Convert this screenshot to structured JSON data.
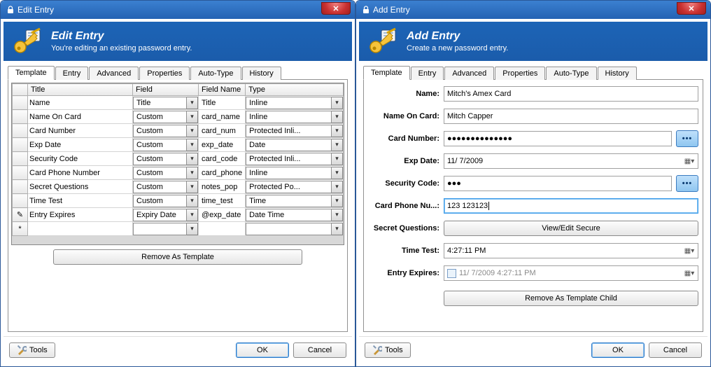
{
  "tabs": [
    "Template",
    "Entry",
    "Advanced",
    "Properties",
    "Auto-Type",
    "History"
  ],
  "left": {
    "title": "Edit Entry",
    "banner_title": "Edit Entry",
    "banner_sub": "You're editing an existing password entry.",
    "grid": {
      "headers": [
        "",
        "Title",
        "Field",
        "Field Name",
        "Type"
      ],
      "rows": [
        {
          "rh": "",
          "title": "Name",
          "field": "Title",
          "fname": "Title",
          "type": "Inline"
        },
        {
          "rh": "",
          "title": "Name On Card",
          "field": "Custom",
          "fname": "card_name",
          "type": "Inline"
        },
        {
          "rh": "",
          "title": "Card Number",
          "field": "Custom",
          "fname": "card_num",
          "type": "Protected Inli..."
        },
        {
          "rh": "",
          "title": "Exp Date",
          "field": "Custom",
          "fname": "exp_date",
          "type": "Date"
        },
        {
          "rh": "",
          "title": "Security Code",
          "field": "Custom",
          "fname": "card_code",
          "type": "Protected Inli..."
        },
        {
          "rh": "",
          "title": "Card Phone Number",
          "field": "Custom",
          "fname": "card_phone",
          "type": "Inline"
        },
        {
          "rh": "",
          "title": "Secret Questions",
          "field": "Custom",
          "fname": "notes_pop",
          "type": "Protected Po..."
        },
        {
          "rh": "",
          "title": "Time Test",
          "field": "Custom",
          "fname": "time_test",
          "type": "Time"
        },
        {
          "rh": "✎",
          "title": "Entry Expires",
          "field": "Expiry Date",
          "fname": "@exp_date",
          "type": "Date Time"
        },
        {
          "rh": "*",
          "title": "",
          "field": "",
          "fname": "",
          "type": ""
        }
      ]
    },
    "remove_btn": "Remove As Template"
  },
  "right": {
    "title": "Add Entry",
    "banner_title": "Add Entry",
    "banner_sub": "Create a new password entry.",
    "form": {
      "name": {
        "label": "Name:",
        "value": "Mitch's Amex Card"
      },
      "name_on_card": {
        "label": "Name On Card:",
        "value": "Mitch Capper"
      },
      "card_number": {
        "label": "Card Number:",
        "value": "●●●●●●●●●●●●●●"
      },
      "exp_date": {
        "label": "Exp Date:",
        "value": "11/ 7/2009"
      },
      "security_code": {
        "label": "Security Code:",
        "value": "●●●"
      },
      "card_phone": {
        "label": "Card Phone Nu...:",
        "value": "123 123123"
      },
      "secret_q": {
        "label": "Secret Questions:",
        "btn": "View/Edit Secure"
      },
      "time_test": {
        "label": "Time Test:",
        "value": "4:27:11 PM"
      },
      "entry_expires": {
        "label": "Entry Expires:",
        "value": "11/ 7/2009   4:27:11 PM"
      }
    },
    "remove_btn": "Remove As Template Child"
  },
  "footer": {
    "tools": "Tools",
    "ok": "OK",
    "cancel": "Cancel"
  }
}
